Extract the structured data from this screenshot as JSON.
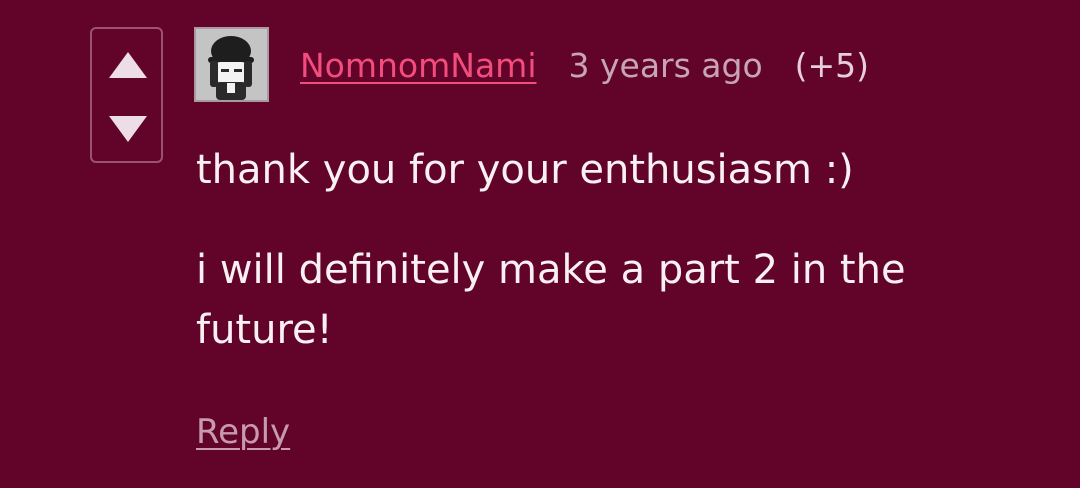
{
  "comment": {
    "username": "NomnomNami",
    "timestamp": "3 years ago",
    "score": "(+5)",
    "paragraphs": [
      "thank you for your enthusiasm :)",
      "i will definitely make a part 2 in the future!"
    ],
    "reply_label": "Reply"
  },
  "icons": {
    "upvote": "triangle-up-icon",
    "downvote": "triangle-down-icon",
    "avatar": "user-avatar-icon"
  },
  "colors": {
    "background": "#620429",
    "username": "#f24d7c",
    "text": "#f8f0f3",
    "muted": "#c7a5b3"
  }
}
